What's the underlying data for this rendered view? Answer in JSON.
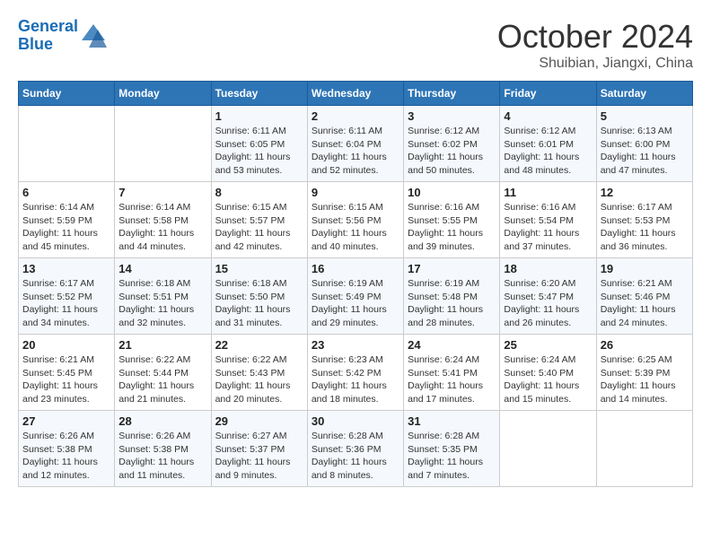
{
  "header": {
    "logo_line1": "General",
    "logo_line2": "Blue",
    "month": "October 2024",
    "location": "Shuibian, Jiangxi, China"
  },
  "days_of_week": [
    "Sunday",
    "Monday",
    "Tuesday",
    "Wednesday",
    "Thursday",
    "Friday",
    "Saturday"
  ],
  "weeks": [
    [
      {
        "day": "",
        "info": ""
      },
      {
        "day": "",
        "info": ""
      },
      {
        "day": "1",
        "info": "Sunrise: 6:11 AM\nSunset: 6:05 PM\nDaylight: 11 hours and 53 minutes."
      },
      {
        "day": "2",
        "info": "Sunrise: 6:11 AM\nSunset: 6:04 PM\nDaylight: 11 hours and 52 minutes."
      },
      {
        "day": "3",
        "info": "Sunrise: 6:12 AM\nSunset: 6:02 PM\nDaylight: 11 hours and 50 minutes."
      },
      {
        "day": "4",
        "info": "Sunrise: 6:12 AM\nSunset: 6:01 PM\nDaylight: 11 hours and 48 minutes."
      },
      {
        "day": "5",
        "info": "Sunrise: 6:13 AM\nSunset: 6:00 PM\nDaylight: 11 hours and 47 minutes."
      }
    ],
    [
      {
        "day": "6",
        "info": "Sunrise: 6:14 AM\nSunset: 5:59 PM\nDaylight: 11 hours and 45 minutes."
      },
      {
        "day": "7",
        "info": "Sunrise: 6:14 AM\nSunset: 5:58 PM\nDaylight: 11 hours and 44 minutes."
      },
      {
        "day": "8",
        "info": "Sunrise: 6:15 AM\nSunset: 5:57 PM\nDaylight: 11 hours and 42 minutes."
      },
      {
        "day": "9",
        "info": "Sunrise: 6:15 AM\nSunset: 5:56 PM\nDaylight: 11 hours and 40 minutes."
      },
      {
        "day": "10",
        "info": "Sunrise: 6:16 AM\nSunset: 5:55 PM\nDaylight: 11 hours and 39 minutes."
      },
      {
        "day": "11",
        "info": "Sunrise: 6:16 AM\nSunset: 5:54 PM\nDaylight: 11 hours and 37 minutes."
      },
      {
        "day": "12",
        "info": "Sunrise: 6:17 AM\nSunset: 5:53 PM\nDaylight: 11 hours and 36 minutes."
      }
    ],
    [
      {
        "day": "13",
        "info": "Sunrise: 6:17 AM\nSunset: 5:52 PM\nDaylight: 11 hours and 34 minutes."
      },
      {
        "day": "14",
        "info": "Sunrise: 6:18 AM\nSunset: 5:51 PM\nDaylight: 11 hours and 32 minutes."
      },
      {
        "day": "15",
        "info": "Sunrise: 6:18 AM\nSunset: 5:50 PM\nDaylight: 11 hours and 31 minutes."
      },
      {
        "day": "16",
        "info": "Sunrise: 6:19 AM\nSunset: 5:49 PM\nDaylight: 11 hours and 29 minutes."
      },
      {
        "day": "17",
        "info": "Sunrise: 6:19 AM\nSunset: 5:48 PM\nDaylight: 11 hours and 28 minutes."
      },
      {
        "day": "18",
        "info": "Sunrise: 6:20 AM\nSunset: 5:47 PM\nDaylight: 11 hours and 26 minutes."
      },
      {
        "day": "19",
        "info": "Sunrise: 6:21 AM\nSunset: 5:46 PM\nDaylight: 11 hours and 24 minutes."
      }
    ],
    [
      {
        "day": "20",
        "info": "Sunrise: 6:21 AM\nSunset: 5:45 PM\nDaylight: 11 hours and 23 minutes."
      },
      {
        "day": "21",
        "info": "Sunrise: 6:22 AM\nSunset: 5:44 PM\nDaylight: 11 hours and 21 minutes."
      },
      {
        "day": "22",
        "info": "Sunrise: 6:22 AM\nSunset: 5:43 PM\nDaylight: 11 hours and 20 minutes."
      },
      {
        "day": "23",
        "info": "Sunrise: 6:23 AM\nSunset: 5:42 PM\nDaylight: 11 hours and 18 minutes."
      },
      {
        "day": "24",
        "info": "Sunrise: 6:24 AM\nSunset: 5:41 PM\nDaylight: 11 hours and 17 minutes."
      },
      {
        "day": "25",
        "info": "Sunrise: 6:24 AM\nSunset: 5:40 PM\nDaylight: 11 hours and 15 minutes."
      },
      {
        "day": "26",
        "info": "Sunrise: 6:25 AM\nSunset: 5:39 PM\nDaylight: 11 hours and 14 minutes."
      }
    ],
    [
      {
        "day": "27",
        "info": "Sunrise: 6:26 AM\nSunset: 5:38 PM\nDaylight: 11 hours and 12 minutes."
      },
      {
        "day": "28",
        "info": "Sunrise: 6:26 AM\nSunset: 5:38 PM\nDaylight: 11 hours and 11 minutes."
      },
      {
        "day": "29",
        "info": "Sunrise: 6:27 AM\nSunset: 5:37 PM\nDaylight: 11 hours and 9 minutes."
      },
      {
        "day": "30",
        "info": "Sunrise: 6:28 AM\nSunset: 5:36 PM\nDaylight: 11 hours and 8 minutes."
      },
      {
        "day": "31",
        "info": "Sunrise: 6:28 AM\nSunset: 5:35 PM\nDaylight: 11 hours and 7 minutes."
      },
      {
        "day": "",
        "info": ""
      },
      {
        "day": "",
        "info": ""
      }
    ]
  ]
}
